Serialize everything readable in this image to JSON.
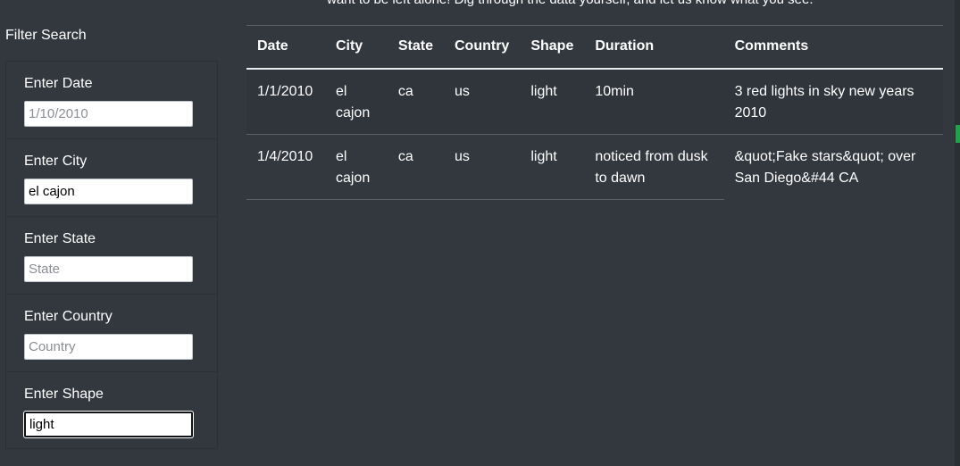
{
  "intro_text": "want to be left alone! Dig through the data yourself, and let us know what you see.",
  "filter": {
    "title": "Filter Search",
    "fields": [
      {
        "label": "Enter Date",
        "value": "",
        "placeholder": "1/10/2010"
      },
      {
        "label": "Enter City",
        "value": "el cajon",
        "placeholder": ""
      },
      {
        "label": "Enter State",
        "value": "",
        "placeholder": "State"
      },
      {
        "label": "Enter Country",
        "value": "",
        "placeholder": "Country"
      },
      {
        "label": "Enter Shape",
        "value": "light",
        "placeholder": ""
      }
    ]
  },
  "table": {
    "headers": [
      "Date",
      "City",
      "State",
      "Country",
      "Shape",
      "Duration",
      "Comments"
    ],
    "rows": [
      [
        "1/1/2010",
        "el cajon",
        "ca",
        "us",
        "light",
        "10min",
        "3 red lights in sky new years 2010"
      ],
      [
        "1/4/2010",
        "el cajon",
        "ca",
        "us",
        "light",
        "noticed from dusk to dawn",
        "&quot;Fake stars&quot; over San Diego&#44 CA"
      ]
    ]
  },
  "colors": {
    "background": "#32383e",
    "accent": "#1fa24a"
  }
}
